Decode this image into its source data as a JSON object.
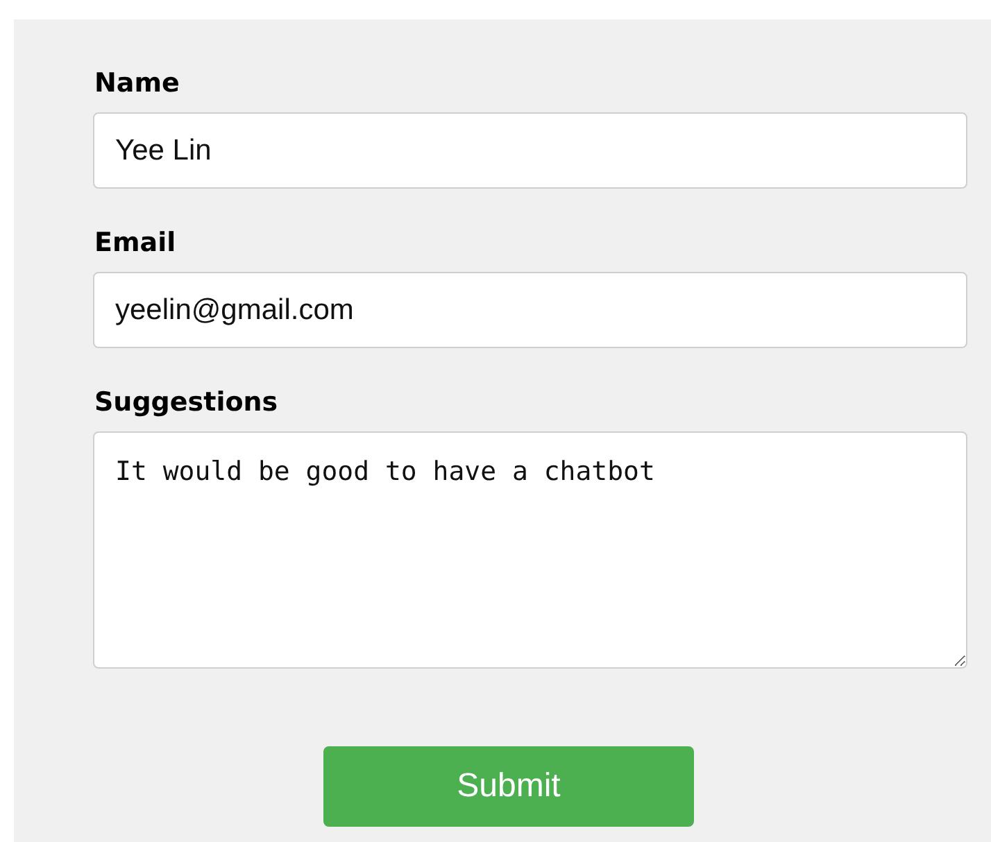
{
  "form": {
    "fields": [
      {
        "kind": "input",
        "label": "Name",
        "value": "Yee Lin"
      },
      {
        "kind": "input",
        "label": "Email",
        "value": "yeelin@gmail.com"
      },
      {
        "kind": "textarea",
        "label": "Suggestions",
        "value": "It would be good to have a chatbot"
      }
    ],
    "submit_button": "Submit"
  }
}
